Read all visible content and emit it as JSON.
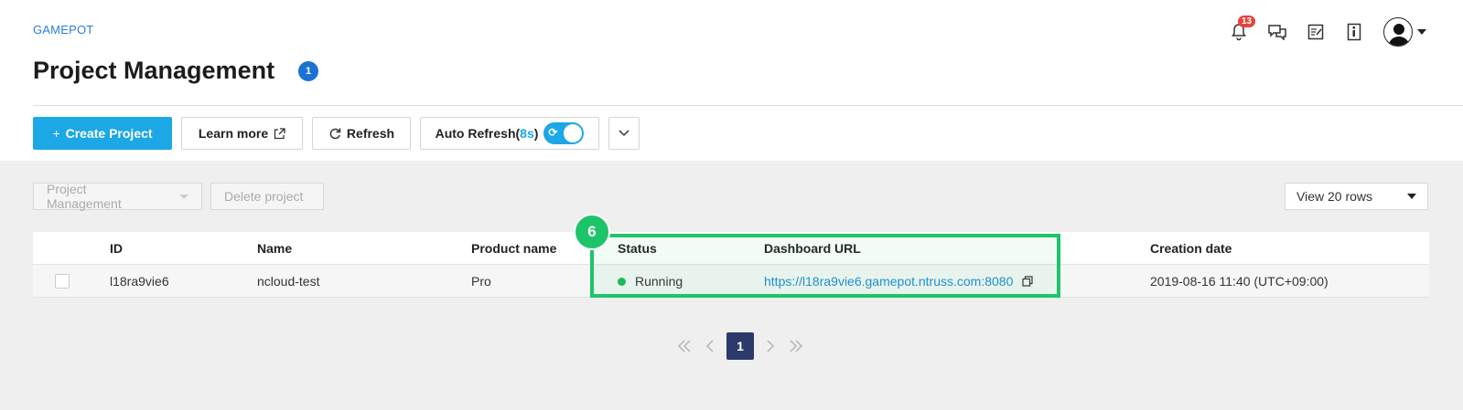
{
  "brand": "GAMEPOT",
  "page": {
    "title": "Project Management",
    "info_badge": "1"
  },
  "header": {
    "notification_count": "13"
  },
  "toolbar": {
    "create_label": "Create Project",
    "learn_more_label": "Learn more",
    "refresh_label": "Refresh",
    "auto_refresh_label": "Auto Refresh(",
    "auto_refresh_interval": "8s",
    "auto_refresh_close": ")",
    "auto_refresh_on": true
  },
  "actions": {
    "project_management": "Project Management",
    "delete_project": "Delete project",
    "view_rows": "View 20 rows"
  },
  "table": {
    "headers": [
      "ID",
      "Name",
      "Product name",
      "Status",
      "Dashboard URL",
      "Creation date"
    ],
    "rows": [
      {
        "id": "l18ra9vie6",
        "name": "ncloud-test",
        "product": "Pro",
        "status": "Running",
        "url": "https://l18ra9vie6.gamepot.ntruss.com:8080",
        "created": "2019-08-16 11:40 (UTC+09:00)"
      }
    ]
  },
  "annotation": {
    "step": "6"
  },
  "pagination": {
    "current": "1"
  },
  "colors": {
    "accent": "#1ca7e6",
    "highlight": "#1ec46a",
    "status_running": "#1fb954",
    "pager_active": "#2b3a6b"
  }
}
